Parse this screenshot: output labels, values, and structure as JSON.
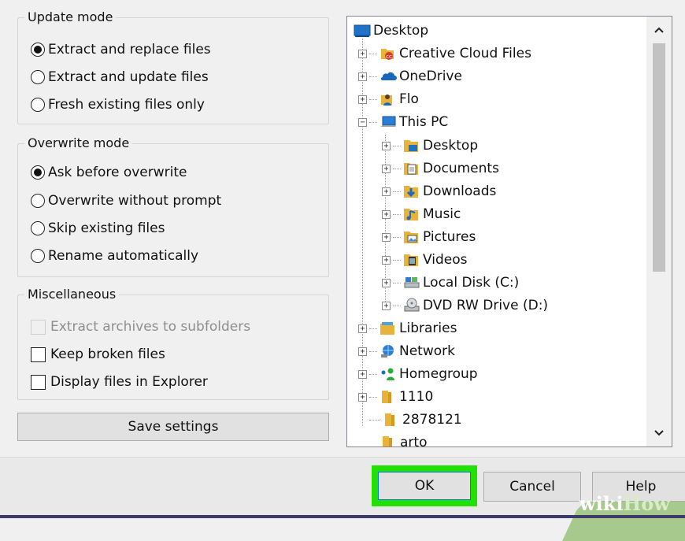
{
  "update_mode": {
    "title": "Update mode",
    "options": [
      {
        "label": "Extract and replace files",
        "selected": true
      },
      {
        "label": "Extract and update files",
        "selected": false
      },
      {
        "label": "Fresh existing files only",
        "selected": false
      }
    ]
  },
  "overwrite_mode": {
    "title": "Overwrite mode",
    "options": [
      {
        "label": "Ask before overwrite",
        "selected": true
      },
      {
        "label": "Overwrite without prompt",
        "selected": false
      },
      {
        "label": "Skip existing files",
        "selected": false
      },
      {
        "label": "Rename automatically",
        "selected": false
      }
    ]
  },
  "misc": {
    "title": "Miscellaneous",
    "options": [
      {
        "label": "Extract archives to subfolders",
        "checked": false,
        "disabled": true
      },
      {
        "label": "Keep broken files",
        "checked": false,
        "disabled": false
      },
      {
        "label": "Display files in Explorer",
        "checked": false,
        "disabled": false
      }
    ]
  },
  "save_settings_label": "Save settings",
  "tree": {
    "items": [
      {
        "label": "Desktop",
        "icon": "desktop-icon"
      },
      {
        "label": "Creative Cloud Files",
        "icon": "creative-cloud-folder-icon"
      },
      {
        "label": "OneDrive",
        "icon": "onedrive-icon"
      },
      {
        "label": "Flo",
        "icon": "user-folder-icon"
      },
      {
        "label": "This PC",
        "icon": "computer-icon"
      },
      {
        "label": "Desktop",
        "icon": "desktop-folder-icon"
      },
      {
        "label": "Documents",
        "icon": "documents-folder-icon"
      },
      {
        "label": "Downloads",
        "icon": "downloads-folder-icon"
      },
      {
        "label": "Music",
        "icon": "music-folder-icon"
      },
      {
        "label": "Pictures",
        "icon": "pictures-folder-icon"
      },
      {
        "label": "Videos",
        "icon": "videos-folder-icon"
      },
      {
        "label": "Local Disk (C:)",
        "icon": "local-disk-icon"
      },
      {
        "label": "DVD RW Drive (D:)",
        "icon": "dvd-drive-icon"
      },
      {
        "label": "Libraries",
        "icon": "libraries-icon"
      },
      {
        "label": "Network",
        "icon": "network-icon"
      },
      {
        "label": "Homegroup",
        "icon": "homegroup-icon"
      },
      {
        "label": "1110",
        "icon": "folder-icon"
      },
      {
        "label": "2878121",
        "icon": "folder-icon"
      },
      {
        "label": "arto",
        "icon": "folder-icon"
      }
    ]
  },
  "buttons": {
    "ok": "OK",
    "cancel": "Cancel",
    "help": "Help"
  },
  "watermark": {
    "part1": "wiki",
    "part2": "How"
  },
  "colors": {
    "highlight": "#22e000",
    "folder": "#e8b33a",
    "accent": "#0078d7"
  }
}
